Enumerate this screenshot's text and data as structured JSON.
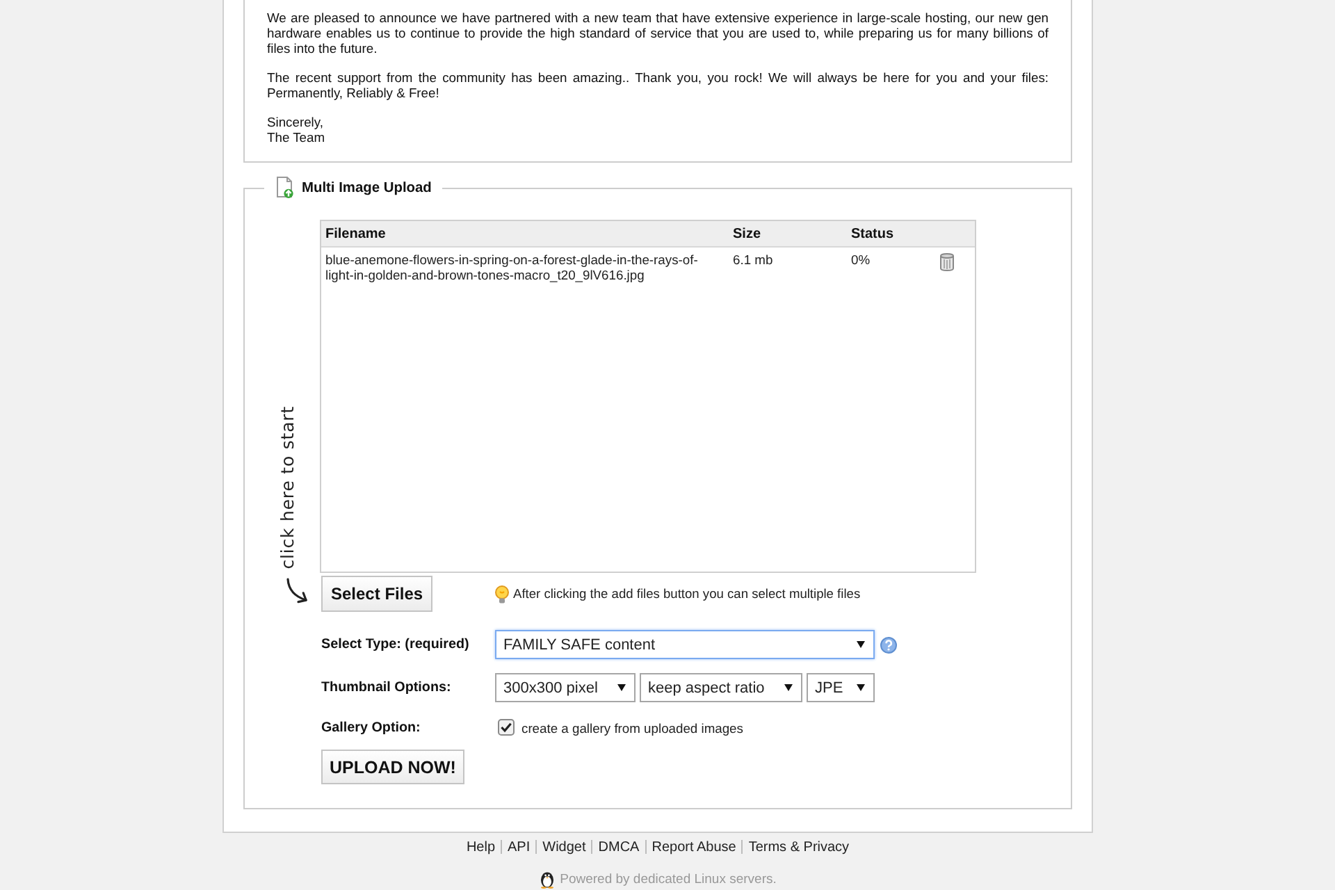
{
  "announcement": {
    "paragraphs": [
      "We are pleased to announce we have partnered with a new team that have extensive experience in large-scale hosting, our new gen hardware enables us to continue to provide the high standard of service that you are used to, while preparing us for many billions of files into the future.",
      "The recent support from the community has been amazing.. Thank you, you rock! We will always be here for you and your files: Permanently, Reliably & Free!"
    ],
    "signoff": [
      "Sincerely,",
      "The Team"
    ]
  },
  "upload_panel": {
    "title": "Multi Image Upload",
    "start_hint": "click here to start",
    "file_list": {
      "columns": [
        "Filename",
        "Size",
        "Status"
      ],
      "rows": [
        {
          "filename": "blue-anemone-flowers-in-spring-on-a-forest-glade-in-the-rays-of-light-in-golden-and-brown-tones-macro_t20_9lV616.jpg",
          "size": "6.1 mb",
          "status": "0%"
        }
      ]
    },
    "select_files_button": "Select Files",
    "tip": "After clicking the add files button you can select multiple files",
    "options": [
      {
        "kind": "dropdowns",
        "label": "Select Type: (required)",
        "dropdowns": [
          {
            "value": "FAMILY SAFE content",
            "focused": true
          }
        ],
        "help": true
      },
      {
        "kind": "dropdowns",
        "label": "Thumbnail Options:",
        "dropdowns": [
          {
            "value": "300x300 pixel",
            "focused": false
          },
          {
            "value": "keep aspect ratio",
            "focused": false
          },
          {
            "value": "JPE",
            "focused": false
          }
        ],
        "help": false
      },
      {
        "kind": "checkbox",
        "label": "Gallery Option:",
        "text": "create a gallery from uploaded images",
        "checked": true
      }
    ],
    "upload_button": "UPLOAD NOW!"
  },
  "footer": {
    "links": [
      "Help",
      "API",
      "Widget",
      "DMCA",
      "Report Abuse",
      "Terms & Privacy"
    ],
    "powered_by": "Powered by dedicated Linux servers."
  }
}
